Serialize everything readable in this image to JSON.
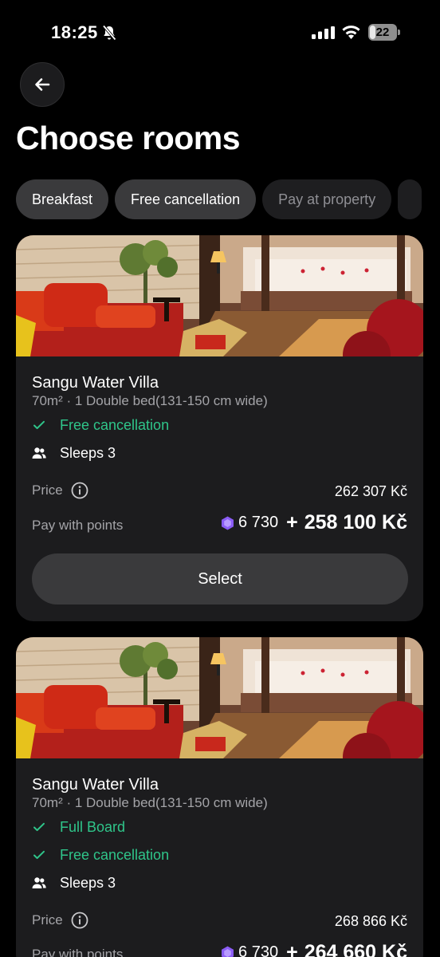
{
  "status_bar": {
    "time": "18:25",
    "battery": "22",
    "battery_level": 0.22
  },
  "page_title": "Choose rooms",
  "filters": [
    {
      "label": "Breakfast",
      "selected": true
    },
    {
      "label": "Free cancellation",
      "selected": true
    },
    {
      "label": "Pay at property",
      "selected": false
    }
  ],
  "rooms": [
    {
      "name": "Sangu Water Villa",
      "details": "70m² · 1 Double bed(131-150 cm wide)",
      "features": [
        "Free cancellation"
      ],
      "sleeps": "Sleeps 3",
      "price_label": "Price",
      "price": "262 307 Kč",
      "points_label": "Pay with points",
      "points": "6 730",
      "plus": "+",
      "points_cash": "258 100 Kč",
      "select_label": "Select"
    },
    {
      "name": "Sangu Water Villa",
      "details": "70m² · 1 Double bed(131-150 cm wide)",
      "features": [
        "Full Board",
        "Free cancellation"
      ],
      "sleeps": "Sleeps 3",
      "price_label": "Price",
      "price": "268 866 Kč",
      "points_label": "Pay with points",
      "points": "6 730",
      "plus": "+",
      "points_cash": "264 660 Kč"
    }
  ],
  "colors": {
    "accent_green": "#2fc58a",
    "points_purple": "#8a5cf5",
    "background": "#000000",
    "card": "#1c1c1e"
  },
  "icons": [
    "bell-slash-icon",
    "signal-icon",
    "wifi-icon",
    "battery-icon",
    "back-arrow-icon",
    "check-icon",
    "people-icon",
    "info-icon",
    "points-hex-icon"
  ]
}
